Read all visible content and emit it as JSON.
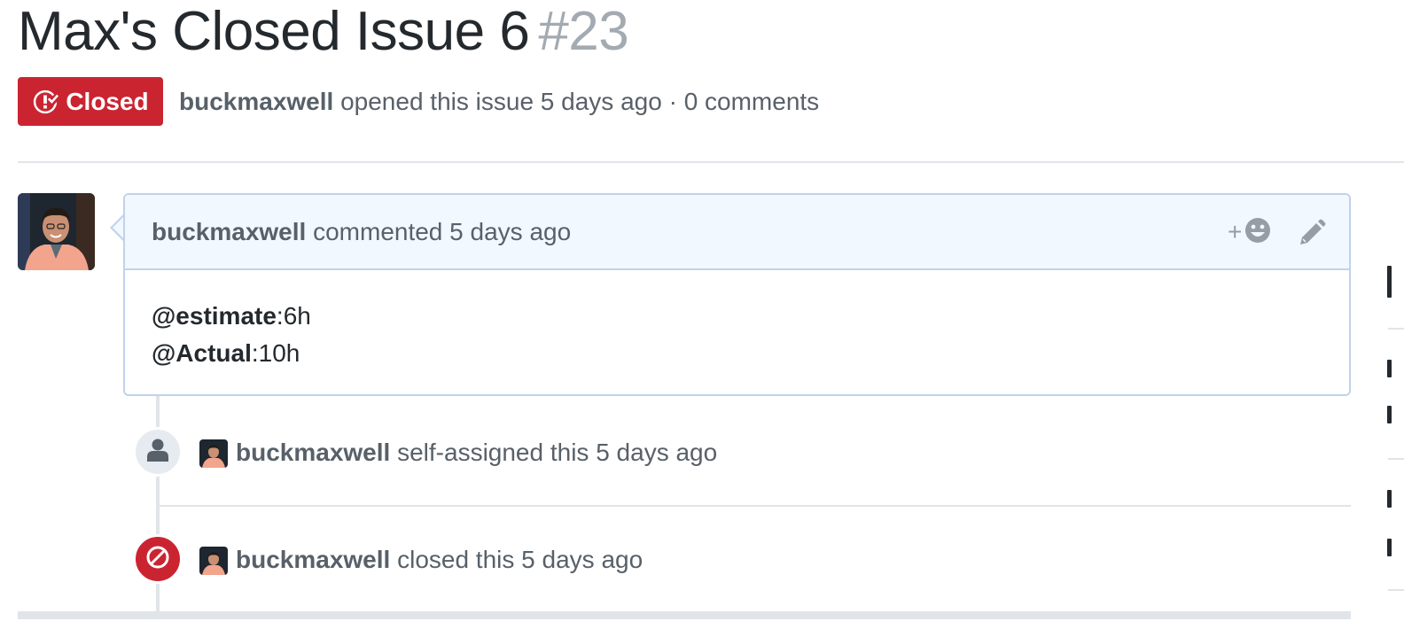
{
  "issue": {
    "title": "Max's Closed Issue 6",
    "number": "#23",
    "state": "Closed",
    "author": "buckmaxwell",
    "opened_text": "opened this issue 5 days ago",
    "separator": "·",
    "comments_count": "0 comments"
  },
  "comment": {
    "author": "buckmaxwell",
    "action": "commented 5 days ago",
    "reaction_plus": "+",
    "lines": [
      {
        "mention": "@estimate",
        "value": ":6h"
      },
      {
        "mention": "@Actual",
        "value": ":10h"
      }
    ]
  },
  "timeline": [
    {
      "author": "buckmaxwell",
      "action": "self-assigned this 5 days ago",
      "badge_icon": "person-icon"
    },
    {
      "author": "buckmaxwell",
      "action": "closed this 5 days ago",
      "badge_icon": "circle-slash-icon"
    }
  ],
  "colors": {
    "closed_red": "#cb2431",
    "comment_header_bg": "#f1f8ff",
    "comment_border": "#c0d3eb",
    "muted_text": "#586069",
    "issue_number": "#a3aab1"
  }
}
